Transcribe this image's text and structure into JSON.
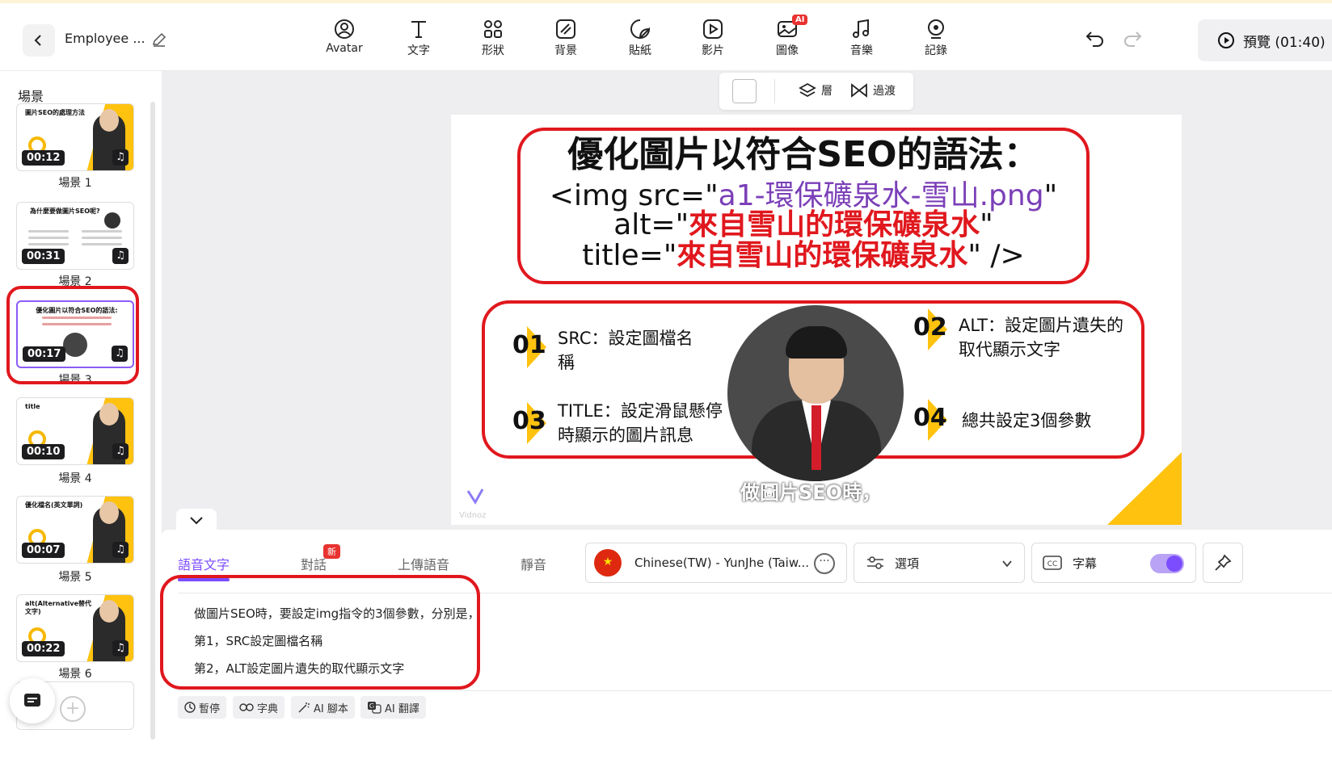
{
  "header": {
    "project_title": "Employee ...",
    "tools": [
      {
        "label": "Avatar",
        "icon": "avatar-icon"
      },
      {
        "label": "文字",
        "icon": "text-icon"
      },
      {
        "label": "形狀",
        "icon": "shapes-icon"
      },
      {
        "label": "背景",
        "icon": "background-icon"
      },
      {
        "label": "貼紙",
        "icon": "sticker-icon"
      },
      {
        "label": "影片",
        "icon": "video-icon"
      },
      {
        "label": "圖像",
        "icon": "image-icon",
        "badge": "AI"
      },
      {
        "label": "音樂",
        "icon": "music-icon"
      },
      {
        "label": "記錄",
        "icon": "record-icon"
      }
    ],
    "preview_label": "預覽 (01:40)"
  },
  "sidebar": {
    "title": "場景",
    "scenes": [
      {
        "label": "場景 1",
        "duration": "00:12",
        "thumb_title": "圖片SEO的處理方法"
      },
      {
        "label": "場景 2",
        "duration": "00:31",
        "thumb_title": "為什麼要做圖片SEO呢?"
      },
      {
        "label": "場景 3",
        "duration": "00:17",
        "thumb_title": "優化圖片以符合SEO的語法:"
      },
      {
        "label": "場景 4",
        "duration": "00:10",
        "thumb_title": "title"
      },
      {
        "label": "場景 5",
        "duration": "00:07",
        "thumb_title": "優化檔名(英文單詞)"
      },
      {
        "label": "場景 6",
        "duration": "00:22",
        "thumb_title": "alt(Alternative替代文字)"
      }
    ],
    "active_scene": 3
  },
  "canvas_toolbar": {
    "layer_label": "層",
    "transition_label": "過渡"
  },
  "slide": {
    "title": "優化圖片以符合SEO的語法：",
    "code_line1_prefix": "<img src=\"",
    "code_line1_value": "a1-環保礦泉水-雪山.png",
    "code_line1_suffix": "\"",
    "code_line2_prefix": "alt=\"",
    "code_line2_value": "來自雪山的環保礦泉水",
    "code_line2_suffix": "\"",
    "code_line3_prefix": "title=\"",
    "code_line3_value": "來自雪山的環保礦泉水",
    "code_line3_suffix": "\" />",
    "params": [
      {
        "num": "01",
        "line1": "SRC：設定圖檔名",
        "line2": "稱"
      },
      {
        "num": "02",
        "line1": "ALT：設定圖片遺失的",
        "line2": "取代顯示文字"
      },
      {
        "num": "03",
        "line1": "TITLE：設定滑鼠懸停",
        "line2": "時顯示的圖片訊息"
      },
      {
        "num": "04",
        "line1": "總共設定3個參數",
        "line2": ""
      }
    ],
    "subtitle": "做圖片SEO時，",
    "logo_text": "Vidnoz"
  },
  "bottom_panel": {
    "tabs": [
      {
        "label": "語音文字",
        "active": true
      },
      {
        "label": "對話",
        "badge": "新"
      },
      {
        "label": "上傳語音"
      },
      {
        "label": "靜音"
      }
    ],
    "voice": "Chinese(TW) - YunJhe (Taiw...",
    "flag_symbol": "★",
    "options_label": "選項",
    "caption_label": "字幕",
    "caption_enabled": true,
    "script_lines": [
      "做圖片SEO時，要設定img指令的3個參數，分別是，",
      "第1，SRC設定圖檔名稱",
      "第2，ALT設定圖片遺失的取代顯示文字"
    ],
    "footer_buttons": [
      {
        "label": "暫停",
        "icon": "clock-icon"
      },
      {
        "label": "字典",
        "icon": "dictionary-icon"
      },
      {
        "label": "AI 腳本",
        "icon": "magic-wand-icon"
      },
      {
        "label": "AI 翻譯",
        "icon": "translate-icon"
      }
    ]
  },
  "colors": {
    "accent": "#7c4dff",
    "highlight_red": "#e0181e",
    "brand_yellow": "#ffc20e"
  }
}
